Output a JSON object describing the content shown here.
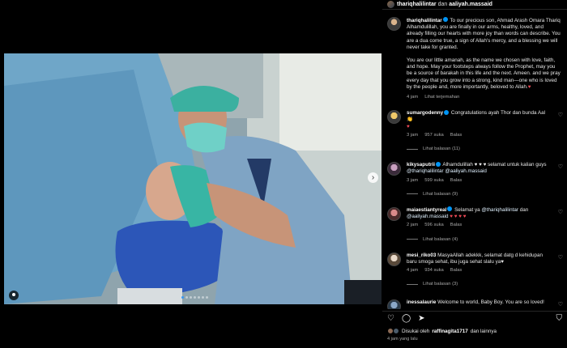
{
  "header": {
    "user_primary": "thariqhalilintar",
    "joiner": "dan",
    "user_secondary": "aaliyah.massaid"
  },
  "post": {
    "pagination": {
      "current": 1,
      "total": 7
    },
    "tag_icon": "person-tag-icon",
    "next_icon": "chevron-right-icon"
  },
  "caption": {
    "username": "thariqhalilintar",
    "line1": "To our precious son, Ahmad Arash Omara Thariq",
    "para1": "Alhamdulillah, you are finally in our arms, healthy, loved, and already filling our hearts with more joy than words can describe. You are a dua come true, a sign of Allah's mercy, and a blessing we will never take for granted.",
    "para2": "You are our little amanah, as the name we chosen with love, faith, and hope. May your footsteps always follow the Prophet, may you be a source of barakah in this life and the next. Ameen. and we pray every day that you grow into a strong, kind man—one who is loved by the people and, more importantly, beloved to Allah.",
    "heart": "♥",
    "time": "4 jam",
    "translate": "Lihat terjemahan"
  },
  "comments": [
    {
      "username": "sumargodenny",
      "verified": true,
      "text": "Congratulations ayah Thor dan bunda Aal👏",
      "extra": "♥",
      "time": "3 jam",
      "likes": "957 suka",
      "reply": "Balas",
      "replies": "Lihat balasan (11)"
    },
    {
      "username": "kikysaputrii",
      "verified": true,
      "text": "Alhamdulillah ♥ ♥ ♥  selamat untuk kalian guys",
      "mention1": "@thariqhalilintar",
      "mention2": "@aaliyah.massaid",
      "time": "3 jam",
      "likes": "599 suka",
      "reply": "Balas",
      "replies": "Lihat balasan (9)"
    },
    {
      "username": "maiaestiantyreal",
      "verified": true,
      "text_pre": "Selamat ya",
      "mention1": "@thariqhalilintar",
      "joiner": "dan",
      "mention2": "@aaliyah.massaid",
      "hearts": "♥ ♥ ♥ ♥",
      "time": "2 jam",
      "likes": "596 suka",
      "reply": "Balas",
      "replies": "Lihat balasan (4)"
    },
    {
      "username": "mesi_riko03",
      "text": "MasyaAllah adekkk, selamat datg d kehidupan baru smoga sehat, ibu juga sehat slalu ya♥",
      "time": "4 jam",
      "likes": "934 suka",
      "reply": "Balas",
      "replies": "Lihat balasan (3)"
    },
    {
      "username": "inessalaurie",
      "text": "Welcome to world, Baby Boy. You are so loved!"
    }
  ],
  "actions": {
    "like_icon": "heart-icon",
    "comment_icon": "comment-icon",
    "share_icon": "share-icon",
    "save_icon": "bookmark-icon"
  },
  "likes": {
    "prefix": "Disukai oleh",
    "user": "raffinagita1717",
    "suffix": "dan lainnya"
  },
  "time_ago": "4 jam yang lalu"
}
